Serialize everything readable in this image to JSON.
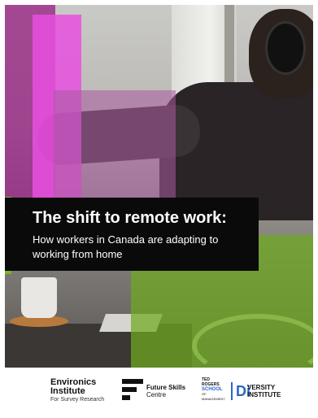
{
  "cover": {
    "title": "The shift to remote work:",
    "subtitle": "How workers in Canada are adapting to working from home"
  },
  "logos": {
    "environics": {
      "line1": "Environics",
      "line2": "Institute",
      "line3": "For Survey Research"
    },
    "future_skills": {
      "line1": "Future Skills",
      "line2": "Centre"
    },
    "ted_rogers": {
      "line1": "TED",
      "line2": "ROGERS",
      "line3": "SCHOOL",
      "line4": "OF MANAGEMENT"
    },
    "diversity": {
      "mark": "Di",
      "line1": "VERSITY",
      "line2": "INSTITUTE"
    }
  },
  "colors": {
    "magenta": "#e850e0",
    "green": "#78b72a",
    "title_bar": "#0a0a0a",
    "brand_blue": "#2a66c7"
  }
}
